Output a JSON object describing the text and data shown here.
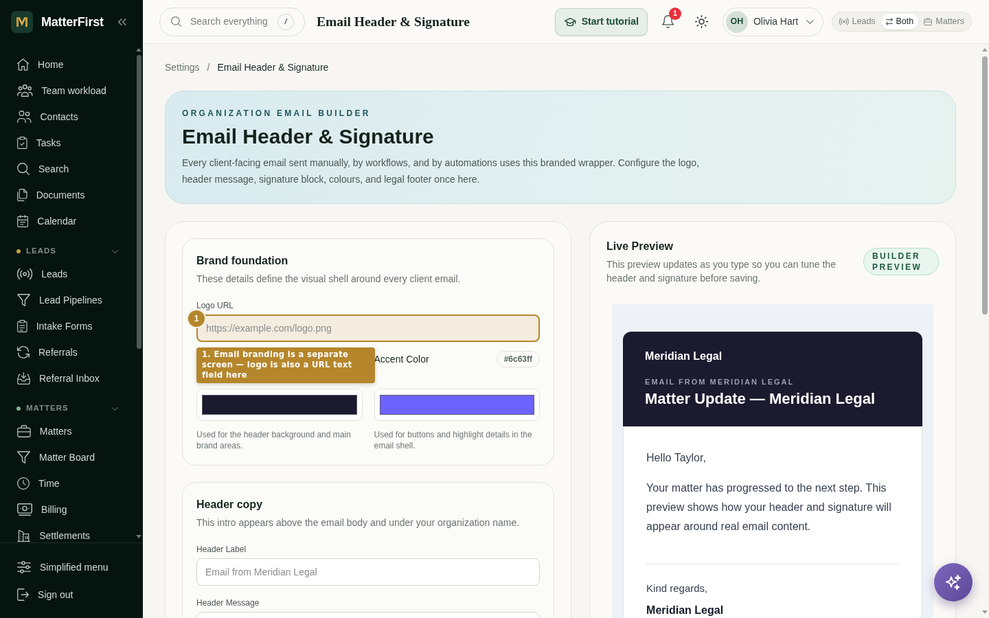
{
  "sidebar": {
    "brand": "MatterFirst",
    "groups": [
      {
        "items": [
          {
            "label": "Home",
            "selected": false
          },
          {
            "label": "Team workload",
            "selected": false
          },
          {
            "label": "Contacts",
            "selected": false
          },
          {
            "label": "Tasks",
            "selected": false
          },
          {
            "label": "Search",
            "selected": false
          },
          {
            "label": "Documents",
            "selected": false
          },
          {
            "label": "Calendar",
            "selected": false
          }
        ]
      },
      {
        "title": "LEADS",
        "color": "#c9a24a",
        "expanded": true,
        "items": [
          {
            "label": "Leads",
            "selected": false
          },
          {
            "label": "Lead Pipelines",
            "selected": false
          },
          {
            "label": "Intake Forms",
            "selected": false
          },
          {
            "label": "Referrals",
            "selected": false
          },
          {
            "label": "Referral Inbox",
            "selected": false
          }
        ]
      },
      {
        "title": "MATTERS",
        "color": "#7db697",
        "expanded": true,
        "items": [
          {
            "label": "Matters",
            "selected": false
          },
          {
            "label": "Matter Board",
            "selected": false
          },
          {
            "label": "Time",
            "selected": false
          },
          {
            "label": "Billing",
            "selected": false
          },
          {
            "label": "Settlements",
            "selected": false
          }
        ]
      }
    ],
    "footer": [
      {
        "label": "Simplified menu"
      },
      {
        "label": "Sign out"
      }
    ]
  },
  "topbar": {
    "search": {
      "placeholder": "Search everything",
      "shortcut": "/"
    },
    "title": "Email Header & Signature",
    "tutorial_button": "Start tutorial",
    "notifications": "1",
    "user": {
      "initials": "OH",
      "name": "Olivia Hart"
    },
    "mode_switch": [
      {
        "label": "Leads",
        "selected": false
      },
      {
        "label": "Both",
        "selected": true
      },
      {
        "label": "Matters",
        "selected": false
      }
    ]
  },
  "breadcrumb": {
    "separator": "/",
    "items": [
      {
        "label": "Settings",
        "current": false
      },
      {
        "label": "Email Header & Signature",
        "current": true
      }
    ]
  },
  "hero": {
    "eyebrow": "ORGANIZATION EMAIL BUILDER",
    "title": "Email Header & Signature",
    "description": "Every client-facing email sent manually, by workflows, and by automations uses this branded wrapper. Configure the logo, header message, signature block, colours, and legal footer once here."
  },
  "form_sections": [
    {
      "title": "Brand foundation",
      "description": "These details define the visual shell around every client email.",
      "fields": [
        {
          "label": "Logo URL",
          "placeholder": "https://example.com/logo.png",
          "highlighted": true,
          "annotation": {
            "marker": "1",
            "text": "1. Email branding is a separate screen — logo is also a URL text field here"
          }
        }
      ],
      "colors": [
        {
          "color": "#1b1a2e",
          "help": "Used for the header background and main brand areas."
        },
        {
          "label": "Accent Color",
          "value": "#6c63ff",
          "color": "#6c63ff",
          "help": "Used for buttons and highlight details in the email shell."
        }
      ]
    },
    {
      "title": "Header copy",
      "description": "This intro appears above the email body and under your organization name.",
      "fields": [
        {
          "label": "Header Label",
          "placeholder": "Email from Meridian Legal",
          "highlighted": false
        },
        {
          "label": "Header Message",
          "highlighted": false
        }
      ]
    }
  ],
  "preview": {
    "title": "Live Preview",
    "description": "This preview updates as you type so you can tune the header and signature before saving.",
    "badge": "BUILDER PREVIEW",
    "email": {
      "org": "Meridian Legal",
      "eyebrow": "EMAIL FROM MERIDIAN LEGAL",
      "subject": "Matter Update — Meridian Legal",
      "greeting": "Hello Taylor,",
      "body": "Your matter has progressed to the next step. This preview shows how your header and signature will appear around real email content.",
      "signoff": "Kind regards,",
      "signature": "Meridian Legal"
    }
  }
}
